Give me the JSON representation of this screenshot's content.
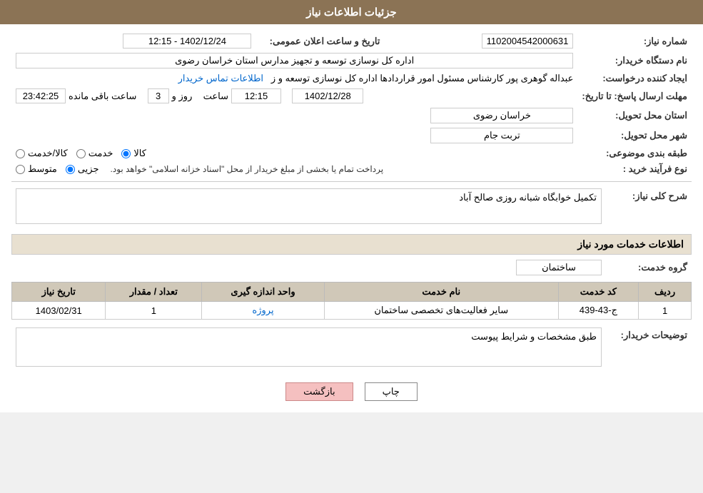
{
  "page": {
    "title": "جزئیات اطلاعات نیاز",
    "header": {
      "title": "جزئیات اطلاعات نیاز"
    },
    "fields": {
      "need_number_label": "شماره نیاز:",
      "need_number_value": "1102004542000631",
      "buyer_org_label": "نام دستگاه خریدار:",
      "buyer_org_value": "اداره کل نوسازی  توسعه و تجهیز مدارس استان خراسان رضوی",
      "creator_label": "ایجاد کننده درخواست:",
      "creator_value": "عبداله گوهری پور کارشناس مسئول امور قراردادها  اداره کل نوسازی  توسعه و ز",
      "creator_link": "اطلاعات تماس خریدار",
      "response_deadline_label": "مهلت ارسال پاسخ: تا تاریخ:",
      "announce_date_label": "تاریخ و ساعت اعلان عمومی:",
      "announce_date_value": "1402/12/24 - 12:15",
      "deadline_date": "1402/12/28",
      "deadline_time": "12:15",
      "deadline_days": "3",
      "deadline_days_label": "روز و",
      "deadline_remaining": "23:42:25",
      "deadline_remaining_label": "ساعت باقی مانده",
      "province_label": "استان محل تحویل:",
      "province_value": "خراسان رضوی",
      "city_label": "شهر محل تحویل:",
      "city_value": "تربت جام",
      "category_label": "طبقه بندی موضوعی:",
      "category_kala": "کالا",
      "category_khadamat": "خدمت",
      "category_kala_khadamat": "کالا/خدمت",
      "purchase_type_label": "نوع فرآیند خرید :",
      "purchase_jozei": "جزیی",
      "purchase_motevaset": "متوسط",
      "purchase_note": "پرداخت تمام یا بخشی از مبلغ خریدار از محل \"اسناد خزانه اسلامی\" خواهد بود.",
      "need_desc_label": "شرح کلی نیاز:",
      "need_desc_value": "تکمیل خوابگاه شبانه روزی صالح آباد",
      "services_info_label": "اطلاعات خدمات مورد نیاز",
      "service_group_label": "گروه خدمت:",
      "service_group_value": "ساختمان",
      "table_headers": {
        "row_num": "ردیف",
        "service_code": "کد خدمت",
        "service_name": "نام خدمت",
        "unit": "واحد اندازه گیری",
        "quantity": "تعداد / مقدار",
        "need_date": "تاریخ نیاز"
      },
      "table_rows": [
        {
          "row_num": "1",
          "service_code": "ج-43-439",
          "service_name": "سایر فعالیت‌های تخصصی ساختمان",
          "unit": "پروژه",
          "quantity": "1",
          "need_date": "1403/02/31"
        }
      ],
      "buyer_desc_label": "توضیحات خریدار:",
      "buyer_desc_value": "طبق مشخصات و شرایط پیوست"
    },
    "buttons": {
      "print": "چاپ",
      "back": "بازگشت"
    }
  }
}
